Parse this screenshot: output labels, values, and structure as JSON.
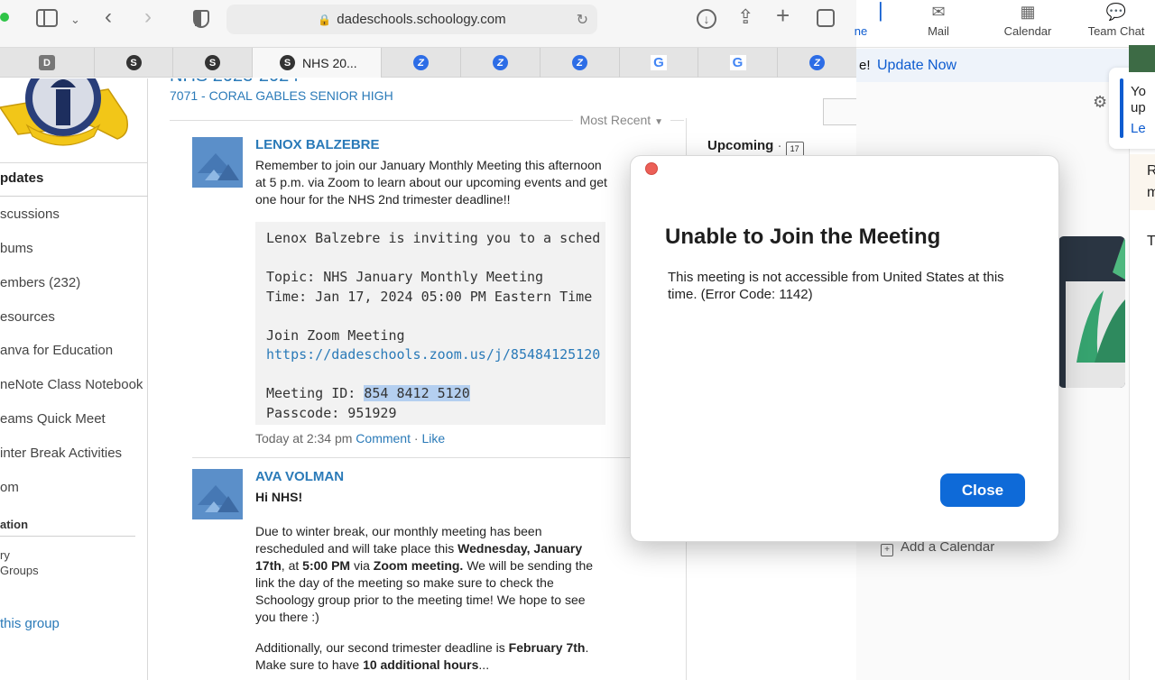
{
  "browser": {
    "url": "dadeschools.schoology.com",
    "tabs": [
      {
        "icon": "d-icon",
        "glyph": "D",
        "title": ""
      },
      {
        "icon": "schoology-icon",
        "glyph": "S",
        "title": ""
      },
      {
        "icon": "schoology-icon",
        "glyph": "S",
        "title": ""
      },
      {
        "icon": "schoology-icon",
        "glyph": "S",
        "title": "NHS 20...",
        "active": true
      },
      {
        "icon": "zoom-icon",
        "glyph": "Z",
        "title": ""
      },
      {
        "icon": "zoom-icon",
        "glyph": "Z",
        "title": ""
      },
      {
        "icon": "zoom-icon",
        "glyph": "Z",
        "title": ""
      },
      {
        "icon": "google-icon",
        "glyph": "G",
        "title": ""
      },
      {
        "icon": "google-icon",
        "glyph": "G",
        "title": ""
      },
      {
        "icon": "zoom-icon",
        "glyph": "Z",
        "title": ""
      }
    ]
  },
  "group": {
    "title": "NHS 2023-2024",
    "school": "7071 - CORAL GABLES SENIOR HIGH"
  },
  "sidebar": {
    "updates": "pdates",
    "items": [
      "scussions",
      "bums",
      "embers (232)",
      "esources",
      "anva for Education",
      "neNote Class Notebook",
      "eams Quick Meet",
      "inter Break Activities",
      "om"
    ],
    "section": "ation",
    "sub_items": [
      "ry",
      "Groups"
    ],
    "leave": "this group"
  },
  "feed": {
    "sort": "Most Recent",
    "posts": [
      {
        "author": "LENOX BALZEBRE",
        "text": "Remember to join our January Monthly Meeting this afternoon at 5 p.m. via Zoom to learn about our upcoming events and get one hour for the NHS 2nd trimester deadline!!",
        "code_lines": [
          "Lenox Balzebre is inviting you to a sched",
          "",
          "Topic: NHS January Monthly Meeting",
          "Time: Jan 17, 2024 05:00 PM Eastern Time",
          "",
          "Join Zoom Meeting"
        ],
        "link": "https://dadeschools.zoom.us/j/85484125120",
        "meeting_id_label": "Meeting ID: ",
        "meeting_id": "854 8412 5120",
        "passcode": "Passcode: 951929",
        "time": "Today at 2:34 pm",
        "comment": "Comment",
        "like": "Like"
      },
      {
        "author": "AVA VOLMAN",
        "greeting": "Hi NHS!",
        "p1_a": "Due to winter break, our monthly meeting has been rescheduled and will take place this ",
        "p1_b": "Wednesday, January 17th",
        "p1_c": ", at ",
        "p1_d": "5:00 PM",
        "p1_e": " via ",
        "p1_f": "Zoom meeting.",
        "p1_g": " We will be sending the link the day of the meeting so make sure to check the Schoology group prior to the meeting time! We hope to see you there :)",
        "p2_a": "Additionally, our second trimester deadline is ",
        "p2_b": "February 7th",
        "p2_c": ". Make sure to have ",
        "p2_d": "10 additional hours",
        "p2_e": "..."
      }
    ]
  },
  "upcoming": {
    "label": "Upcoming"
  },
  "zoom": {
    "tabs": [
      "ne",
      "Mail",
      "Calendar",
      "Team Chat"
    ],
    "banner_text": "e!",
    "update_now": "Update Now",
    "toast_lines": [
      "Yo",
      "up",
      "Le"
    ],
    "side_letters": [
      "R",
      "m",
      "T"
    ],
    "add_calendar": "Add a Calendar",
    "accent": "#0e5cd0"
  },
  "dialog": {
    "title": "Unable to Join the Meeting",
    "message": "This meeting is not accessible from United States at this time. (Error Code: 1142)",
    "close": "Close"
  }
}
